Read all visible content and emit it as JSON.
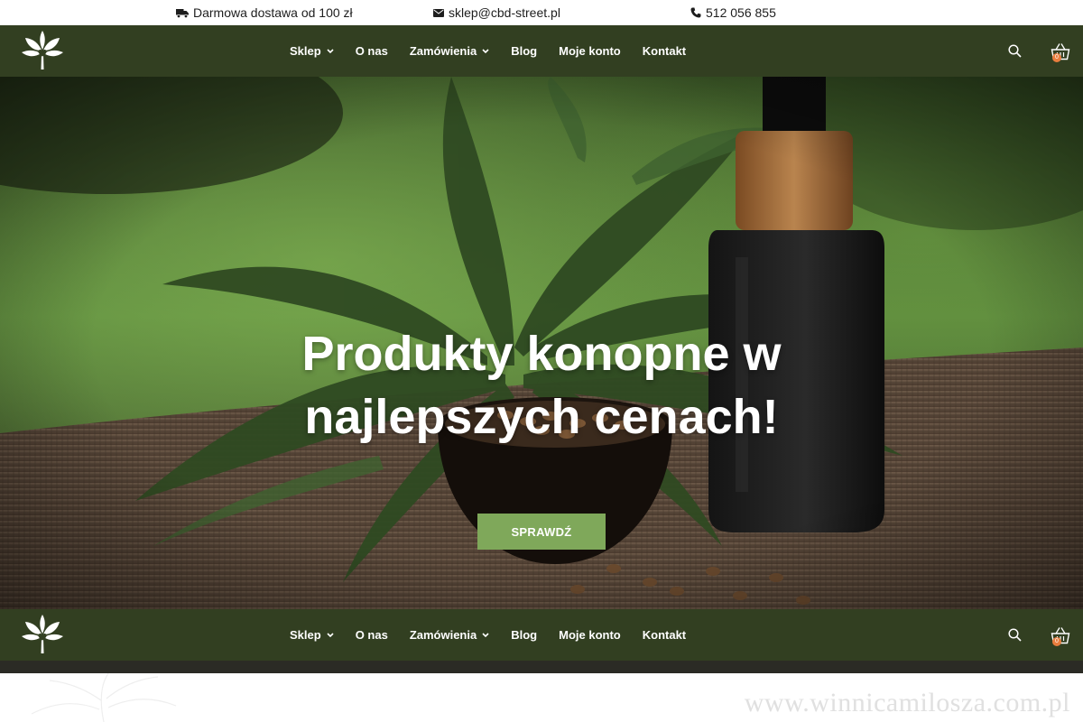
{
  "topbar": {
    "shipping": {
      "icon": "truck-icon",
      "text": "Darmowa dostawa od 100 zł"
    },
    "email": {
      "icon": "envelope-icon",
      "text": "sklep@cbd-street.pl"
    },
    "phone": {
      "icon": "phone-icon",
      "text": "512 056 855"
    }
  },
  "nav": {
    "logo_icon": "cannabis-leaf-heart-logo",
    "items": [
      {
        "label": "Sklep",
        "has_dropdown": true
      },
      {
        "label": "O nas",
        "has_dropdown": false
      },
      {
        "label": "Zamówienia",
        "has_dropdown": true
      },
      {
        "label": "Blog",
        "has_dropdown": false
      },
      {
        "label": "Moje konto",
        "has_dropdown": false
      },
      {
        "label": "Kontakt",
        "has_dropdown": false
      }
    ],
    "search_icon": "search-icon",
    "cart_icon": "basket-icon",
    "cart_count": "0"
  },
  "hero": {
    "title_line1": "Produkty konopne w",
    "title_line2": "najlepszych cenach!",
    "button_label": "SPRAWDŹ"
  },
  "watermark": "www.winnicamilosza.com.pl",
  "colors": {
    "nav_bg": "#323f21",
    "accent_button": "#7fa85a",
    "cart_badge": "#e87d3e"
  }
}
